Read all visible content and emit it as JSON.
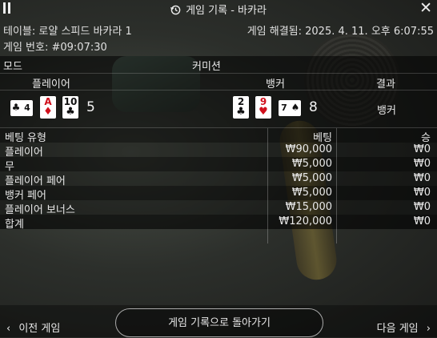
{
  "window": {
    "title": "게임 기록 - 바카라"
  },
  "info": {
    "table": "테이블: 로얄 스피드 바카라 1",
    "game_number": "게임 번호: #09:07:30",
    "resolved": "게임 해결됨: 2025. 4. 11. 오후 6:07:55"
  },
  "mode_header": {
    "mode": "모드",
    "commission": "커미션"
  },
  "result_header": {
    "player": "플레이어",
    "banker": "뱅커",
    "result": "결과"
  },
  "hands": {
    "player": {
      "cards": [
        {
          "rank": "4",
          "suit": "♣",
          "color": "black",
          "orientation": "sideways"
        },
        {
          "rank": "A",
          "suit": "♦",
          "color": "red",
          "orientation": "upright"
        },
        {
          "rank": "10",
          "suit": "♣",
          "color": "black",
          "orientation": "upright"
        }
      ],
      "score": "5"
    },
    "banker": {
      "cards": [
        {
          "rank": "2",
          "suit": "♣",
          "color": "black",
          "orientation": "upright"
        },
        {
          "rank": "9",
          "suit": "♥",
          "color": "red",
          "orientation": "upright"
        },
        {
          "rank": "7",
          "suit": "♠",
          "color": "black",
          "orientation": "sideways"
        }
      ],
      "score": "8"
    },
    "result": "뱅커"
  },
  "bets": {
    "headers": {
      "type": "베팅 유형",
      "bet": "베팅",
      "win": "승"
    },
    "rows": [
      {
        "type": "플레이어",
        "bet": "₩90,000",
        "win": "₩0"
      },
      {
        "type": "무",
        "bet": "₩5,000",
        "win": "₩0"
      },
      {
        "type": "플레이어 페어",
        "bet": "₩5,000",
        "win": "₩0"
      },
      {
        "type": "뱅커 페어",
        "bet": "₩5,000",
        "win": "₩0"
      },
      {
        "type": "플레이어 보너스",
        "bet": "₩15,000",
        "win": "₩0"
      }
    ],
    "total": {
      "type": "합계",
      "bet": "₩120,000",
      "win": "₩0"
    }
  },
  "footer": {
    "prev": "이전 게임",
    "back": "게임 기록으로 돌아가기",
    "next": "다음 게임"
  },
  "colors": {
    "red_suit": "#d0101c",
    "black_suit": "#111111",
    "text": "#e8e8e8"
  }
}
